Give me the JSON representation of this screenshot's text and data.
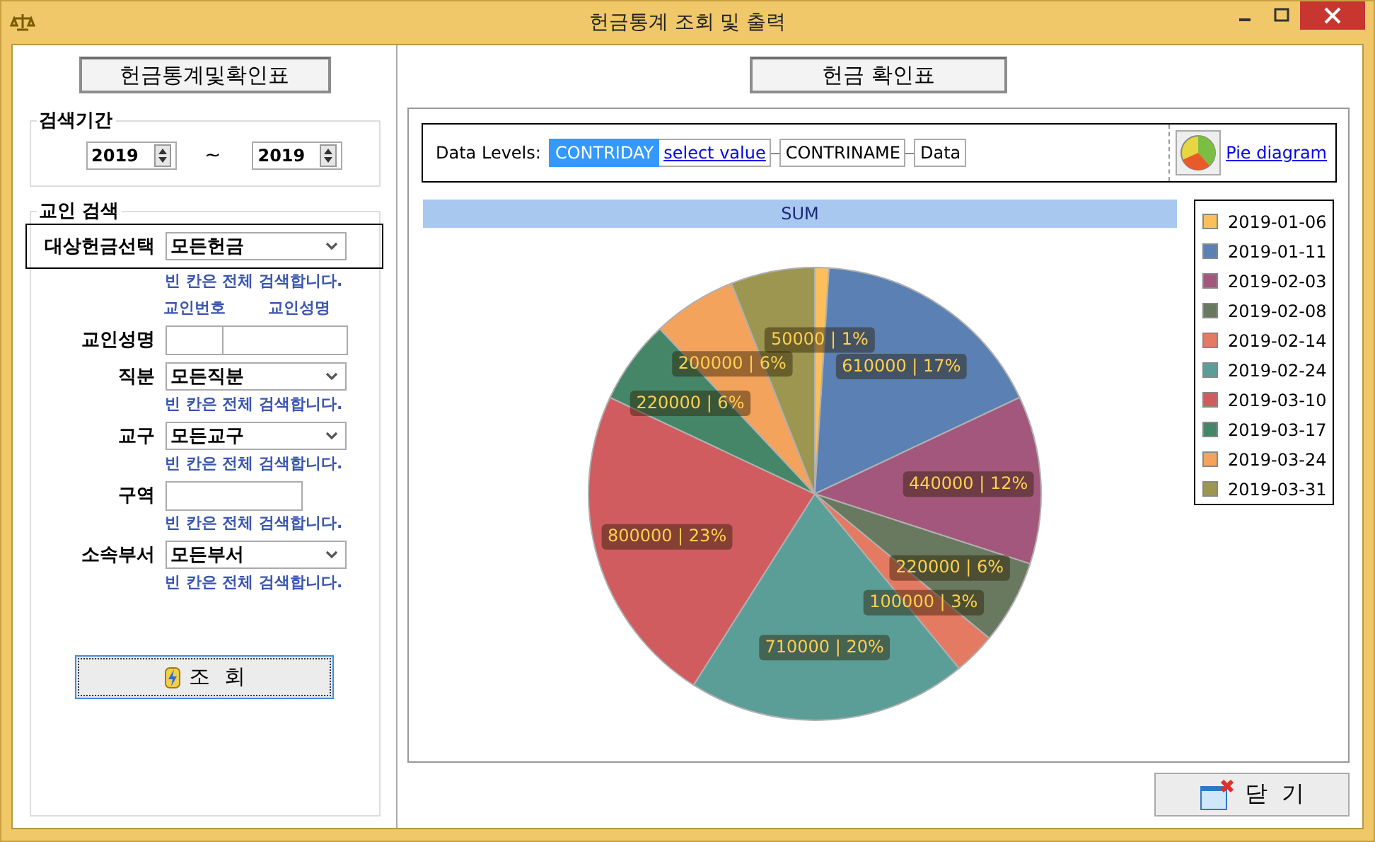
{
  "window": {
    "title": "헌금통계 조회 및 출력"
  },
  "left": {
    "heading": "헌금통계및확인표",
    "period": {
      "legend": "검색기간",
      "from": "2019",
      "separator": "~",
      "to": "2019"
    },
    "search": {
      "legend": "교인 검색",
      "rows": [
        {
          "kind": "select",
          "label": "대상헌금선택",
          "value": "모든헌금",
          "hint": "빈 칸은 전체 검색합니다.",
          "framed": true
        },
        {
          "kind": "pair",
          "label": "교인성명",
          "captions": [
            "교인번호",
            "교인성명"
          ]
        },
        {
          "kind": "select",
          "label": "직분",
          "value": "모든직분",
          "hint": "빈 칸은 전체 검색합니다.",
          "framed": false
        },
        {
          "kind": "select",
          "label": "교구",
          "value": "모든교구",
          "hint": "빈 칸은 전체 검색합니다.",
          "framed": false
        },
        {
          "kind": "text",
          "label": "구역",
          "hint": "빈 칸은 전체 검색합니다."
        },
        {
          "kind": "select",
          "label": "소속부서",
          "value": "모든부서",
          "hint": "빈 칸은 전체 검색합니다.",
          "framed": false
        }
      ]
    },
    "query_button": "조  회"
  },
  "right": {
    "heading": "헌금 확인표",
    "toolbar": {
      "label": "Data Levels:",
      "levels": [
        {
          "text": "CONTRIDAY",
          "selected": true
        },
        {
          "text": "select value",
          "kind": "link"
        },
        {
          "text": "CONTRINAME",
          "selected": false
        },
        {
          "text": "Data",
          "selected": false
        }
      ],
      "diagram_link": "Pie diagram"
    },
    "chart_data": {
      "type": "pie",
      "legend": "right",
      "categories": [
        "2019-01-06",
        "2019-01-11",
        "2019-02-03",
        "2019-02-08",
        "2019-02-14",
        "2019-02-24",
        "2019-03-10",
        "2019-03-17",
        "2019-03-24",
        "2019-03-31"
      ],
      "series": [
        {
          "name": "SUM",
          "colors": [
            "#fcbf5a",
            "#5a80b4",
            "#a4577c",
            "#687960",
            "#e57a62",
            "#5b9e98",
            "#d05c60",
            "#458668",
            "#f4a35c",
            "#9c9651"
          ],
          "values": [
            1,
            17,
            12,
            6,
            3,
            20,
            23,
            6,
            6,
            6
          ]
        }
      ],
      "value_labels": [
        "50000 | 1%",
        "610000 | 17%",
        "440000 | 12%",
        "220000 | 6%",
        "100000 | 3%",
        "710000 | 20%",
        "800000 | 23%",
        "220000 | 6%",
        "200000 | 6%",
        null
      ]
    },
    "close_button": "닫  기"
  }
}
